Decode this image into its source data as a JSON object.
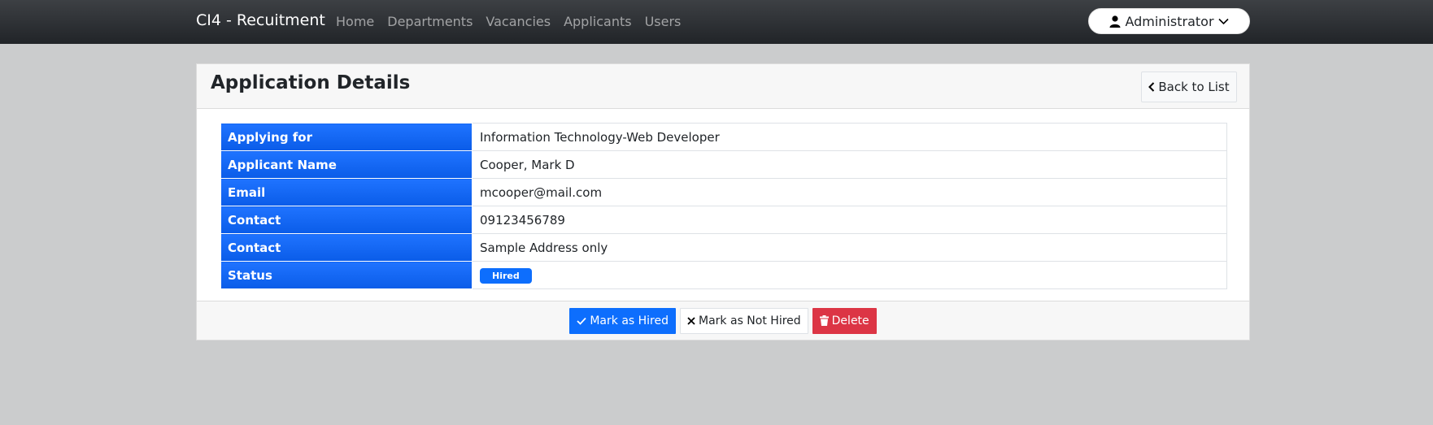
{
  "navbar": {
    "brand": "CI4 - Recuitment",
    "links": [
      "Home",
      "Departments",
      "Vacancies",
      "Applicants",
      "Users"
    ],
    "user_label": "Administrator"
  },
  "card": {
    "title": "Application Details",
    "back_label": "Back to List",
    "rows": [
      {
        "label": "Applying for",
        "value": "Information Technology-Web Developer"
      },
      {
        "label": "Applicant Name",
        "value": "Cooper, Mark D"
      },
      {
        "label": "Email",
        "value": "mcooper@mail.com"
      },
      {
        "label": "Contact",
        "value": "09123456789"
      },
      {
        "label": "Contact",
        "value": "Sample Address only"
      },
      {
        "label": "Status",
        "value": "Hired"
      }
    ]
  },
  "footer": {
    "mark_hired": "Mark as Hired",
    "mark_not_hired": "Mark as Not Hired",
    "delete": "Delete"
  },
  "colors": {
    "primary": "#0d6efd",
    "danger": "#dc3545",
    "navbar": "#2b2e32",
    "background": "#cbcccd"
  },
  "icons": {
    "user": "user-icon",
    "chevron": "chevron-down-icon",
    "back": "chevron-left-icon",
    "check": "check-icon",
    "x": "x-icon",
    "trash": "trash-icon"
  }
}
